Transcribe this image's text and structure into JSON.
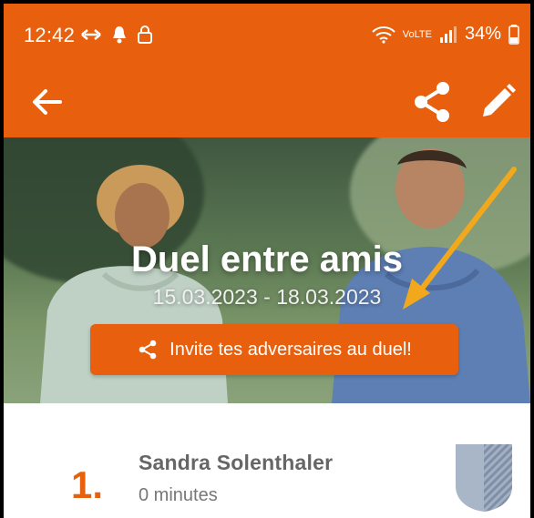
{
  "status": {
    "time": "12:42",
    "battery": "34%",
    "network": "VoLTE"
  },
  "appbar": {
    "back_icon": "arrow-left-icon",
    "share_icon": "share-icon",
    "edit_icon": "pencil-icon"
  },
  "hero": {
    "title": "Duel entre amis",
    "dates": "15.03.2023 - 18.03.2023",
    "invite_label": "Invite tes adversaires au duel!"
  },
  "ranking": [
    {
      "rank": "1.",
      "name": "Sandra  Solenthaler",
      "value": "0 minutes"
    }
  ],
  "colors": {
    "accent": "#e8600e",
    "annotation_arrow": "#f2a81d"
  }
}
